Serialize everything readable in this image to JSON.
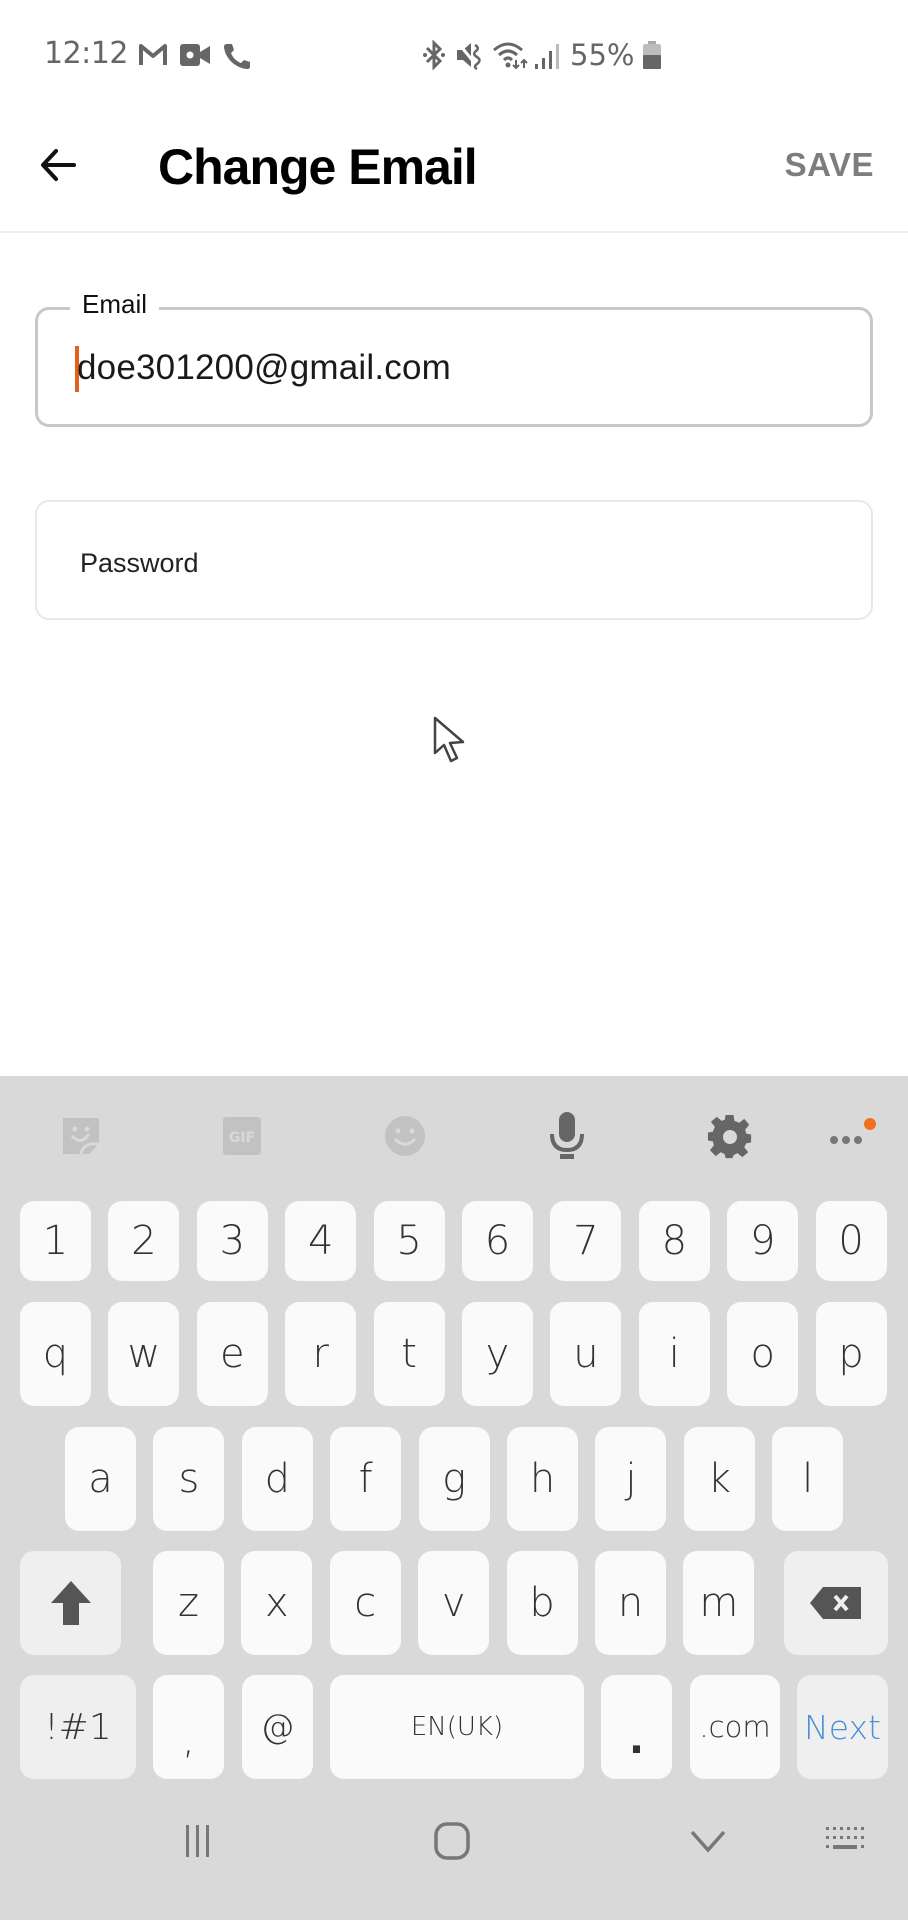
{
  "status_bar": {
    "time": "12:12",
    "left_icons": [
      "gmail-icon",
      "video-call-icon",
      "phone-icon"
    ],
    "right_icons": [
      "bluetooth-icon",
      "mute-vibrate-icon",
      "wifi-icon",
      "signal-icon",
      "battery-icon"
    ],
    "battery_percent": "55%",
    "battery_level": 0.55
  },
  "app_bar": {
    "back_icon": "arrow-left-icon",
    "title": "Change Email",
    "save_label": "SAVE"
  },
  "form": {
    "email": {
      "label": "Email",
      "value": "doe301200@gmail.com",
      "focused": true
    },
    "password": {
      "placeholder": "Password",
      "value": ""
    }
  },
  "keyboard": {
    "toolbar": [
      {
        "name": "sticker-icon",
        "enabled": false
      },
      {
        "name": "gif-icon",
        "label": "GIF",
        "enabled": false
      },
      {
        "name": "emoji-icon",
        "enabled": false
      },
      {
        "name": "microphone-icon",
        "enabled": true
      },
      {
        "name": "settings-gear-icon",
        "enabled": true
      },
      {
        "name": "more-options-icon",
        "enabled": true,
        "notification_dot": true
      }
    ],
    "rows": {
      "numbers": [
        "1",
        "2",
        "3",
        "4",
        "5",
        "6",
        "7",
        "8",
        "9",
        "0"
      ],
      "row1": [
        "q",
        "w",
        "e",
        "r",
        "t",
        "y",
        "u",
        "i",
        "o",
        "p"
      ],
      "row2": [
        "a",
        "s",
        "d",
        "f",
        "g",
        "h",
        "j",
        "k",
        "l"
      ],
      "row3": [
        "z",
        "x",
        "c",
        "v",
        "b",
        "n",
        "m"
      ]
    },
    "shift_icon": "shift-arrow-icon",
    "backspace_icon": "backspace-icon",
    "bottom": {
      "symbols": "!#1",
      "comma": ",",
      "at": "@",
      "space": "EN(UK)",
      "period": ".",
      "dotcom": ".com",
      "action": "Next"
    }
  },
  "nav_bar": {
    "recents_icon": "recents-icon",
    "home_icon": "home-icon",
    "back_icon": "hide-keyboard-chevron-icon",
    "keyboard_icon": "keyboard-switch-icon"
  },
  "colors": {
    "caret": "#e2601a",
    "action_key": "#4a8fd8",
    "notification_dot": "#f07020",
    "keyboard_bg": "#d9d9d9",
    "save_disabled": "#7d7d7d"
  }
}
